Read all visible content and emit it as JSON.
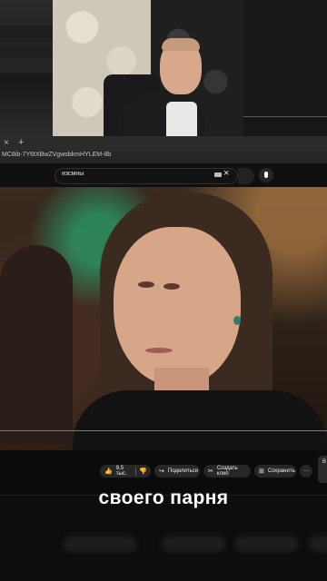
{
  "browser": {
    "url": "MC8ib-7Y6tXBwZVgwsbkmHYLEM-8b",
    "search_query": "изсмны",
    "tab_close": "×",
    "tab_new": "+"
  },
  "actions": {
    "likes": "9,5 тыс.",
    "like_icon": "thumbs-up-icon",
    "dislike_icon": "thumbs-down-icon",
    "share": "Поделиться",
    "clip": "Создать клип",
    "save": "Сохранить",
    "more": "···",
    "side_chip": "В"
  },
  "caption": "своего парня",
  "icons": {
    "clear": "×",
    "share": "↪",
    "clip": "✂",
    "save": "⊞",
    "like": "👍",
    "dislike": "👎"
  }
}
